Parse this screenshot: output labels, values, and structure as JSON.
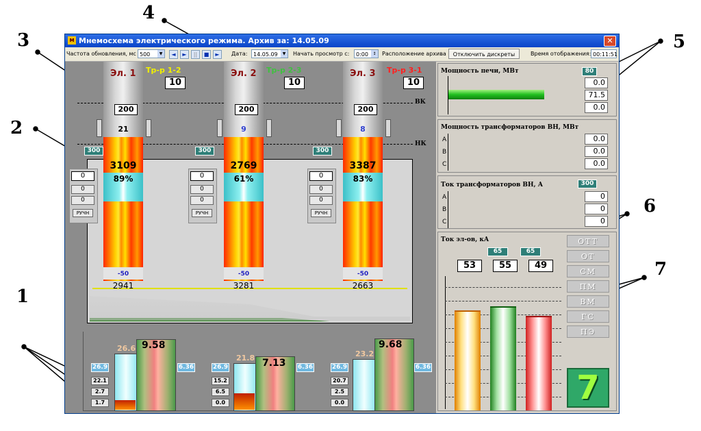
{
  "callouts": [
    "1",
    "2",
    "3",
    "4",
    "5",
    "6",
    "7"
  ],
  "window": {
    "title": "Мнемосхема электрического режима. Архив за: 14.05.09",
    "close_glyph": "✕",
    "app_icon": "mnemo-icon"
  },
  "toolbar": {
    "refresh_label": "Частота обновления, мс",
    "refresh_value": "500",
    "date_label": "Дата:",
    "date_value": "14.05.09",
    "start_label": "Начать просмотр с:",
    "start_value": "0:00",
    "archive_location_label": "Расположение архива",
    "disable_discretes_label": "Отключить дискреты",
    "display_time_label": "Время отображения:",
    "display_time_value": "00:11:51",
    "nav_glyphs": [
      "◄",
      "►",
      "||",
      "■",
      "►"
    ]
  },
  "furnace": {
    "bk_label": "ВК",
    "nk_label": "НК",
    "electrodes": [
      {
        "name": "Эл. 1",
        "transformer": "Тр-р 1-2",
        "transformer_color": "#f0f000",
        "tap": "10",
        "position_box": "200",
        "depth": "21",
        "depth_color": "#3040d0",
        "nk_value": "300",
        "power": "3109",
        "percent": "89%",
        "bottom_value": "-50",
        "below": "2941",
        "ctrl_top": "0",
        "ctrl_mid": "0",
        "ctrl_low": "0",
        "mode": "РУЧН"
      },
      {
        "name": "Эл. 2",
        "transformer": "Тр-р 2-3",
        "transformer_color": "#40c040",
        "tap": "10",
        "position_box": "200",
        "depth": "9",
        "depth_color": "#3040d0",
        "nk_value": "300",
        "power": "2769",
        "percent": "61%",
        "bottom_value": "-50",
        "below": "3281",
        "ctrl_top": "0",
        "ctrl_mid": "0",
        "ctrl_low": "0",
        "mode": "РУЧН"
      },
      {
        "name": "Эл. 3",
        "transformer": "Тр-р 3-1",
        "transformer_color": "#ff2020",
        "tap": "10",
        "position_box": "200",
        "depth": "8",
        "depth_color": "#3040d0",
        "nk_value": "300",
        "power": "3387",
        "percent": "83%",
        "bottom_value": "-50",
        "below": "2663",
        "ctrl_top": "0",
        "ctrl_mid": "0",
        "ctrl_low": "0",
        "mode": "РУЧН"
      }
    ]
  },
  "phase_bars": [
    {
      "left_label": "26.9",
      "top_value": "26.6",
      "big_value": "9.58",
      "right_label": "6.36",
      "stack": [
        "22.1",
        "2.7",
        "1.7"
      ],
      "fill_cyan": 0.82,
      "fill_big": 1.0
    },
    {
      "left_label": "26.9",
      "top_value": "21.8",
      "big_value": "7.13",
      "right_label": "6.36",
      "stack": [
        "15.2",
        "6.5",
        "0.0"
      ],
      "fill_cyan": 0.67,
      "fill_big": 0.74
    },
    {
      "left_label": "26.9",
      "top_value": "23.2",
      "big_value": "9.68",
      "right_label": "6.36",
      "stack": [
        "20.7",
        "2.5",
        "0.0"
      ],
      "fill_cyan": 0.72,
      "fill_big": 1.0
    }
  ],
  "right_panel": {
    "furnace_power": {
      "label": "Мощность печи, МВт",
      "max": "80",
      "values": [
        "0.0",
        "71.5",
        "0.0"
      ],
      "fill": 0.89
    },
    "transformer_power": {
      "label": "Мощность трансформаторов ВН, МВт",
      "phases": [
        "A",
        "B",
        "C"
      ],
      "values": [
        "0.0",
        "0.0",
        "0.0"
      ]
    },
    "transformer_current": {
      "label": "Ток трансформаторов ВН, А",
      "max": "300",
      "phases": [
        "A",
        "B",
        "C"
      ],
      "values": [
        "0",
        "0",
        "0"
      ]
    },
    "electrode_current": {
      "label": "Ток эл-ов, кА",
      "limits": [
        "65",
        "65"
      ],
      "values": [
        "53",
        "55",
        "49"
      ],
      "bar_fill": [
        0.74,
        0.77,
        0.69
      ]
    },
    "status_buttons": [
      "ОТТ",
      "ОТ",
      "СМ",
      "ПМ",
      "ВМ",
      "ГС",
      "ПЭ"
    ],
    "step_indicator": "7",
    "colors": {
      "teal": "#2f7f78",
      "green_indicator": "#2fa868",
      "furnace_bar": "#40d040"
    }
  }
}
